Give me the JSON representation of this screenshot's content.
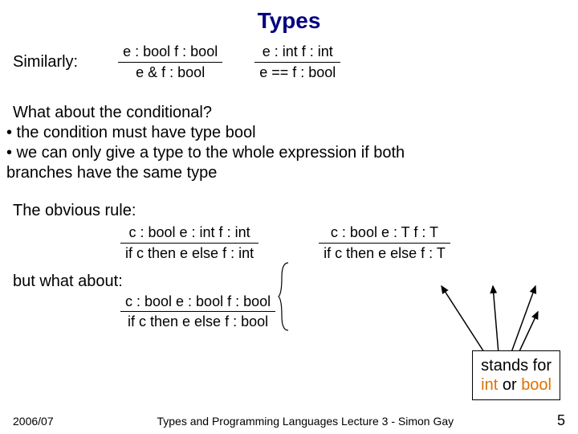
{
  "title": "Types",
  "similarly": "Similarly:",
  "rule1": {
    "top": "e : bool    f : bool",
    "bot": "e & f : bool"
  },
  "rule2": {
    "top": "e : int    f : int",
    "bot": "e == f : bool"
  },
  "what_about": "What about the conditional?",
  "bullet1_prefix": "• the condition must have type  ",
  "bullet1_type": "bool",
  "bullet2": "• we can only give a type to the whole expression if both",
  "bullet2b": "  branches have the same type",
  "obvious": "The obvious rule:",
  "rule3": {
    "top": "c : bool   e : int   f : int",
    "bot": "if c then e else f : int"
  },
  "rule4": {
    "top": "c : bool   e : T   f : T",
    "bot": "if c then e else f : T"
  },
  "but_about": "but what about:",
  "rule5": {
    "top": "c : bool   e : bool   f : bool",
    "bot": "if c then e else f : bool"
  },
  "legend1": "stands for",
  "legend2a": "int",
  "legend2b": " or ",
  "legend2c": "bool",
  "footer_left": "2006/07",
  "footer_mid": "Types and Programming Languages Lecture 3 - Simon Gay",
  "footer_right": "5"
}
